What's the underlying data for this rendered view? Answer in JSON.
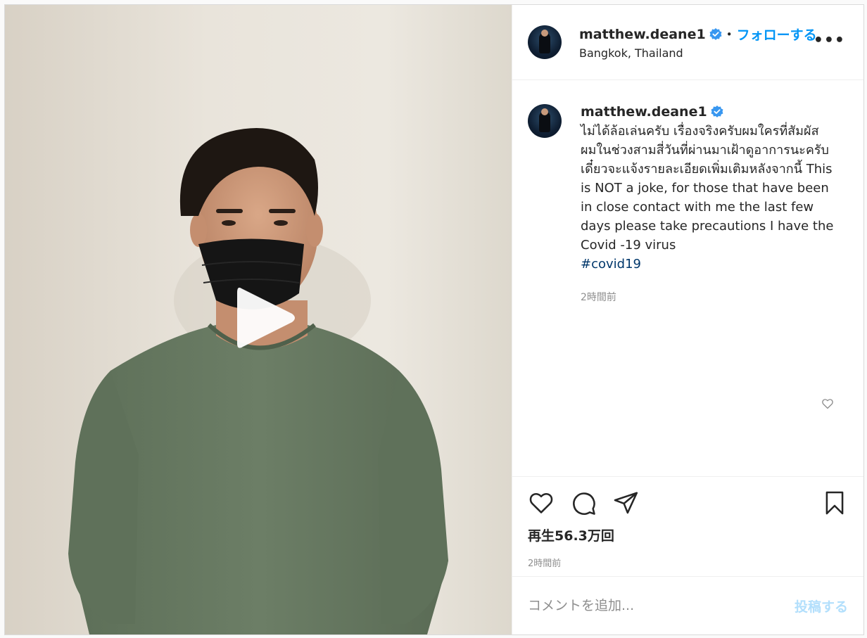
{
  "header": {
    "username": "matthew.deane1",
    "separator": "•",
    "follow_label": "フォローする",
    "location": "Bangkok, Thailand",
    "more_label": "•••"
  },
  "caption": {
    "username": "matthew.deane1",
    "text": "ไม่ได้ล้อเล่นครับ เรื่องจริงครับผมใครที่สัมผัสผมในช่วงสามสี่วันที่ผ่านมาเฝ้าดูอาการนะครับ เดี๋ยวจะแจ้งรายละเอียดเพิ่มเติมหลังจากนี้ This is NOT a joke, for those that have been in close contact with me the last few days please take precautions I have the Covid -19 virus",
    "hashtag": "#covid19",
    "time": "2時間前"
  },
  "actions": {
    "views": "再生56.3万回",
    "time": "2時間前"
  },
  "comment": {
    "placeholder": "コメントを追加...",
    "post_label": "投稿する"
  },
  "icons": {
    "like": "heart-icon",
    "comment": "comment-icon",
    "share": "share-icon",
    "save": "bookmark-icon",
    "verified": "verified-badge-icon",
    "play": "play-icon"
  },
  "colors": {
    "accent": "#0095f6",
    "hashtag": "#00376b",
    "muted": "#8e8e8e",
    "post_button_disabled": "#b2dffc"
  }
}
